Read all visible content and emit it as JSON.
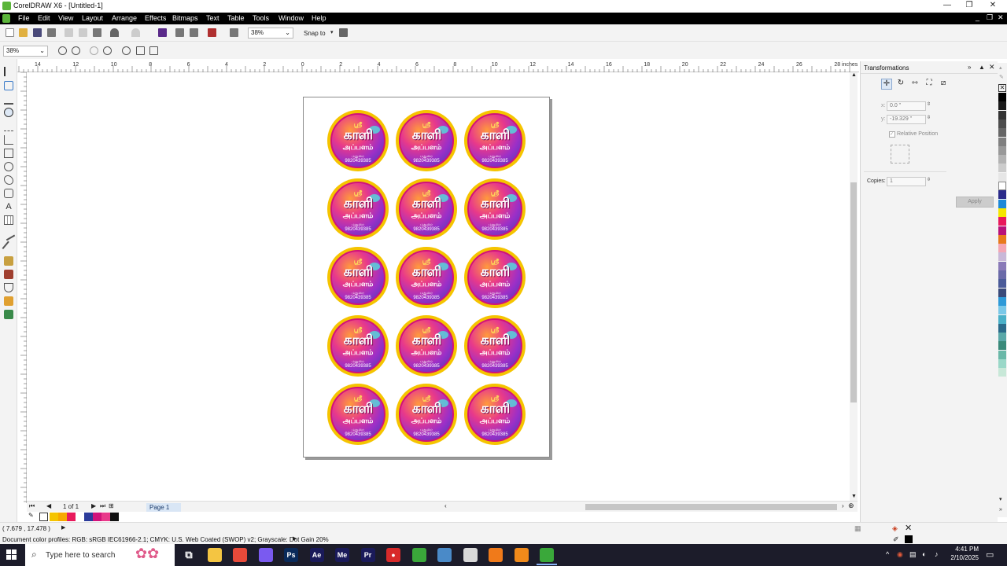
{
  "window": {
    "title": "CorelDRAW X6 - [Untitled-1]",
    "controls": [
      "—",
      "❐",
      "✕"
    ]
  },
  "menu": {
    "items": [
      "File",
      "Edit",
      "View",
      "Layout",
      "Arrange",
      "Effects",
      "Bitmaps",
      "Text",
      "Table",
      "Tools",
      "Window",
      "Help"
    ],
    "doc_controls": [
      "_",
      "❐",
      "✕"
    ]
  },
  "toolbar": {
    "zoom_value": "38%",
    "snap_to_label": "Snap to"
  },
  "zoombar": {
    "zoom_value": "38%"
  },
  "ruler": {
    "h_labels": [
      "14",
      "12",
      "10",
      "8",
      "6",
      "4",
      "2",
      "0",
      "2",
      "4",
      "6",
      "8",
      "10",
      "12",
      "14",
      "16",
      "18",
      "20",
      "22",
      "24",
      "26",
      "28"
    ],
    "units": "inches"
  },
  "stickers": {
    "top_text": "ஸ்ரீ",
    "main_text": "காளி",
    "sub_text": "அப்பளம்",
    "small_text": "மதுரை",
    "phone_text": "9820439385",
    "count": 15,
    "colors": {
      "ring": "#f5c400",
      "border": "#d1127a"
    }
  },
  "page_nav": {
    "counter": "1 of 1",
    "page_tab": "Page 1"
  },
  "status": {
    "coords": "( 7.679 , 17.478 )",
    "color_profiles": "Document color profiles: RGB: sRGB IEC61966-2.1; CMYK: U.S. Web Coated (SWOP) v2; Grayscale: Dot Gain 20%"
  },
  "docker": {
    "title": "Transformations",
    "x_label": "x:",
    "x_value": "0.0 \"",
    "y_label": "y:",
    "y_value": "-19.329 \"",
    "relative_position_label": "Relative Position",
    "copies_label": "Copies:",
    "copies_value": "1",
    "apply_label": "Apply"
  },
  "document_palette": [
    "#f5c400",
    "#f7a800",
    "#e8195c",
    "#ffffff",
    "#2b3b9a",
    "#d1127a",
    "#e8398a",
    "#111111"
  ],
  "color_palette": [
    "#000000",
    "#1a1a1a",
    "#333333",
    "#4d4d4d",
    "#666666",
    "#808080",
    "#999999",
    "#b3b3b3",
    "#cccccc",
    "#e6e6e6",
    "#ffffff",
    "#2a2a8a",
    "#1e88d8",
    "#f5e600",
    "#e8195c",
    "#b8127a",
    "#e87a1c",
    "#f4a6b4",
    "#c9b8d8",
    "#8a7ab8",
    "#6a6aa8",
    "#4a5a98",
    "#3a4a7a",
    "#2e9ad8",
    "#7ac8e8",
    "#4ab0c8",
    "#2a6a8a",
    "#5aa8a8",
    "#3a8a7a",
    "#6ab8a8",
    "#9ad8c8",
    "#c8e8d8"
  ],
  "taskbar": {
    "search_placeholder": "Type here to search",
    "time": "4:41 PM",
    "date": "2/10/2025",
    "apps": [
      {
        "name": "task-view",
        "label": "⧉",
        "color": "#1c1c2a"
      },
      {
        "name": "file-explorer",
        "label": "",
        "color": "#f4c542"
      },
      {
        "name": "chrome",
        "label": "",
        "color": "#e84a3a"
      },
      {
        "name": "copilot",
        "label": "",
        "color": "#7a5af0"
      },
      {
        "name": "photoshop",
        "label": "Ps",
        "color": "#0a2a5a"
      },
      {
        "name": "after-effects",
        "label": "Ae",
        "color": "#1a1a5a"
      },
      {
        "name": "media-encoder",
        "label": "Me",
        "color": "#1a1a5a"
      },
      {
        "name": "premiere",
        "label": "Pr",
        "color": "#1a1a5a"
      },
      {
        "name": "recorder",
        "label": "●",
        "color": "#d82a2a"
      },
      {
        "name": "coreldraw",
        "label": "",
        "color": "#3aa83a"
      },
      {
        "name": "corel-font",
        "label": "",
        "color": "#4a8ac8"
      },
      {
        "name": "inkscape",
        "label": "",
        "color": "#d8d8d8"
      },
      {
        "name": "firefox",
        "label": "",
        "color": "#f07a1a"
      },
      {
        "name": "blender",
        "label": "",
        "color": "#f08a1a"
      },
      {
        "name": "coreldraw-active",
        "label": "",
        "color": "#3aa83a"
      }
    ],
    "tray": [
      "^",
      "◉",
      "▤",
      "◐",
      "♪",
      "中"
    ]
  }
}
